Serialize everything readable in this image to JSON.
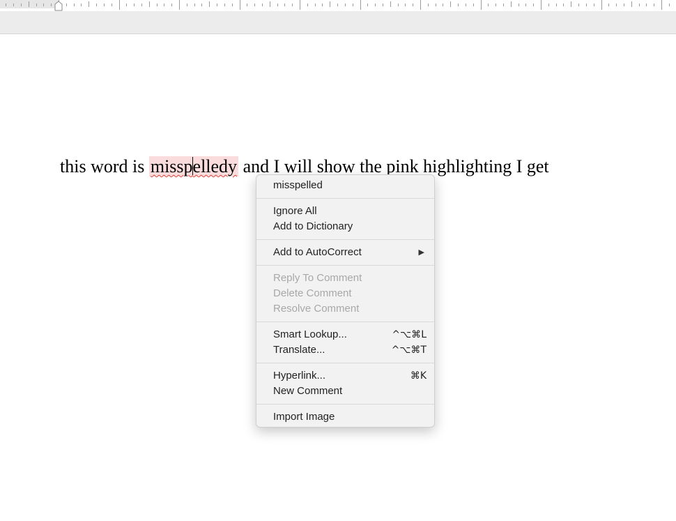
{
  "document": {
    "text_before": "this word is ",
    "misspelled_part1": "missp",
    "misspelled_part2": "elledy",
    "text_after": " and I will show the pink highlighting I get"
  },
  "context_menu": {
    "suggestion": "misspelled",
    "ignore_all": "Ignore All",
    "add_to_dictionary": "Add to Dictionary",
    "add_to_autocorrect": "Add to AutoCorrect",
    "submenu_arrow": "▶",
    "reply_to_comment": "Reply To Comment",
    "delete_comment": "Delete Comment",
    "resolve_comment": "Resolve Comment",
    "smart_lookup": "Smart Lookup...",
    "smart_lookup_shortcut": "^⌥⌘L",
    "translate": "Translate...",
    "translate_shortcut": "^⌥⌘T",
    "hyperlink": "Hyperlink...",
    "hyperlink_shortcut": "⌘K",
    "new_comment": "New Comment",
    "import_image": "Import Image"
  },
  "colors": {
    "misspelling_highlight": "#fbdcdc",
    "squiggle": "#e0433c",
    "disabled_text": "#a8a8a8"
  }
}
